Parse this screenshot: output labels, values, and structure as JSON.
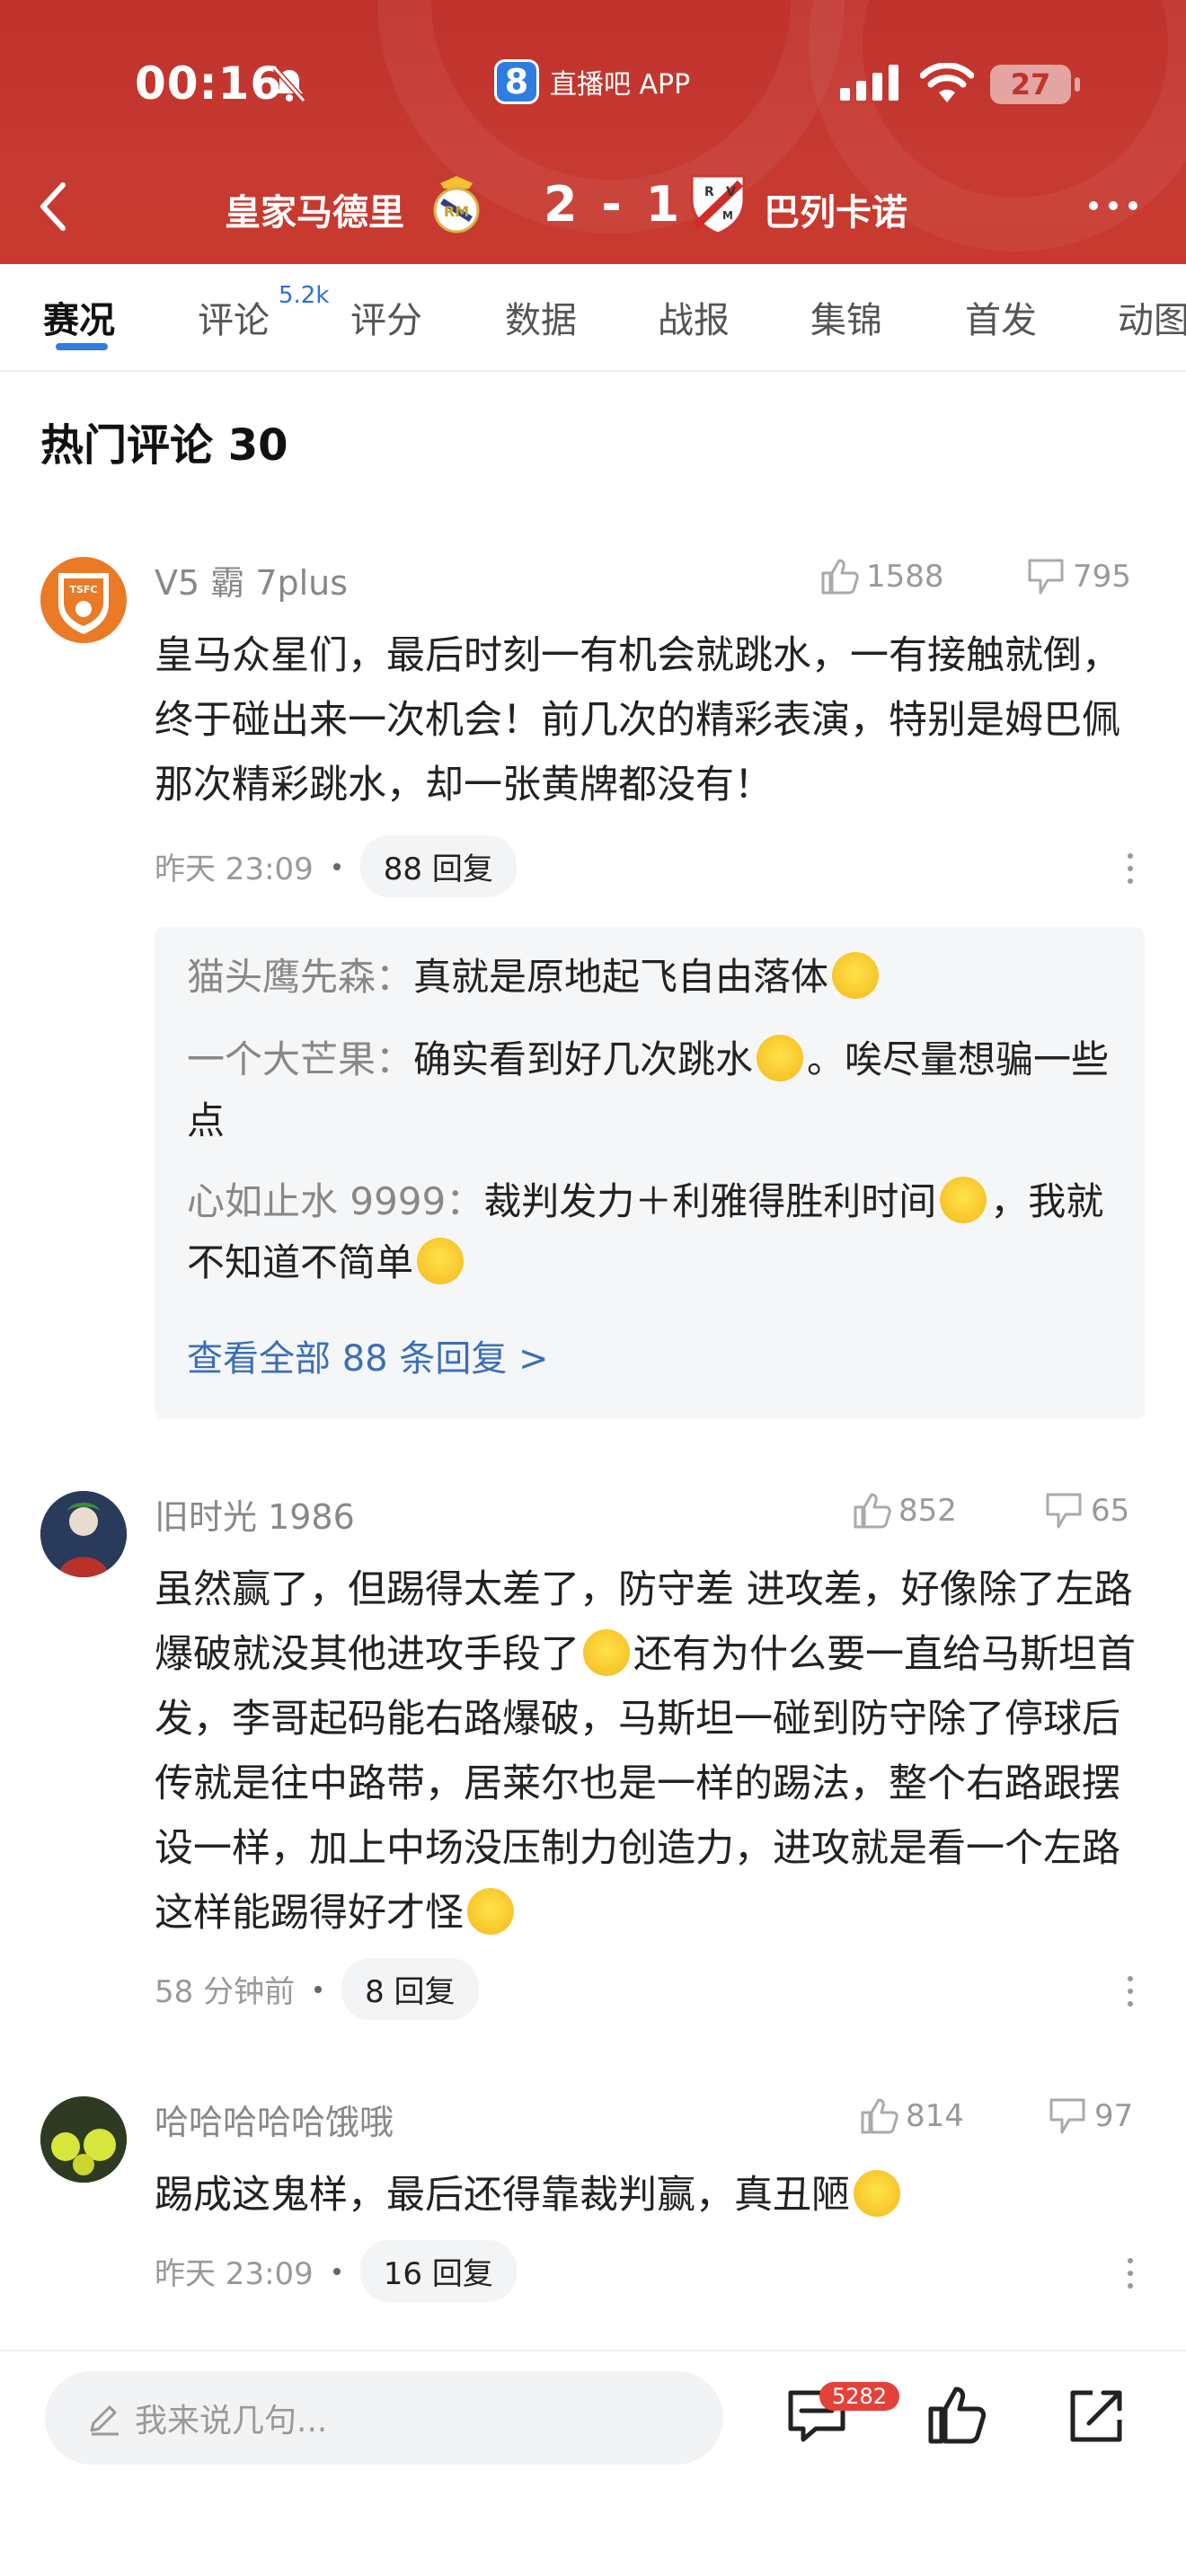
{
  "status_bar": {
    "time": "00:16",
    "app_name": "直播吧 APP",
    "app_logo": "8",
    "battery": "27"
  },
  "match": {
    "home_team": "皇家马德里",
    "score": "2 - 1",
    "away_team": "巴列卡诺"
  },
  "tabs": [
    {
      "label": "赛况",
      "active": true
    },
    {
      "label": "评论",
      "badge": "5.2k"
    },
    {
      "label": "评分"
    },
    {
      "label": "数据"
    },
    {
      "label": "战报"
    },
    {
      "label": "集锦"
    },
    {
      "label": "首发"
    },
    {
      "label": "动图"
    }
  ],
  "section_title": "热门评论 30",
  "comments": [
    {
      "user": "V5 霸 7plus",
      "likes": "1588",
      "dislikes": "795",
      "text": "皇马众星们，最后时刻一有机会就跳水，一有接触就倒，终于碰出来一次机会！前几次的精彩表演，特别是姆巴佩那次精彩跳水，却一张黄牌都没有！",
      "time": "昨天 23:09",
      "replies_label": "88 回复",
      "replies": [
        {
          "name": "猫头鹰先森：",
          "text": "真就是原地起飞自由落体"
        },
        {
          "name": "一个大芒果：",
          "text": "确实看到好几次跳水",
          "text2": "。唉尽量想骗一些点"
        },
        {
          "name": "心如止水 9999：",
          "text": "裁判发力＋利雅得胜利时间",
          "text2": "，我就不知道不简单"
        }
      ],
      "view_all": "查看全部 88 条回复 >"
    },
    {
      "user": "旧时光 1986",
      "likes": "852",
      "dislikes": "65",
      "text": "虽然赢了，但踢得太差了，防守差 进攻差，好像除了左路爆破就没其他进攻手段了",
      "text2": "还有为什么要一直给马斯坦首发，李哥起码能右路爆破，马斯坦一碰到防守除了停球后传就是往中路带，居莱尔也是一样的踢法，整个右路跟摆设一样，加上中场没压制力创造力，进攻就是看一个左路 这样能踢得好才怪",
      "time": "58 分钟前",
      "replies_label": "8 回复"
    },
    {
      "user": "哈哈哈哈哈饿哦",
      "likes": "814",
      "dislikes": "97",
      "text": "踢成这鬼样，最后还得靠裁判赢，真丑陋",
      "time": "昨天 23:09",
      "replies_label": "16 回复"
    }
  ],
  "bottom_bar": {
    "placeholder": "我来说几句...",
    "comment_count": "5282"
  },
  "colors": {
    "header_red": "#c0322c",
    "accent_blue": "#2f7de1",
    "link_blue": "#3b6fb6",
    "badge_red": "#e5413b"
  }
}
